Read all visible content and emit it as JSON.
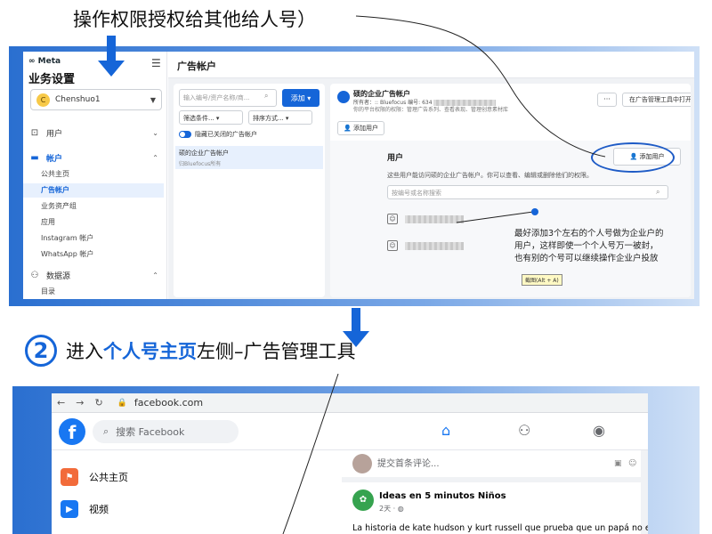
{
  "captions": {
    "step1": "操作权限授权给其他给人号）",
    "step2_num": "2",
    "step2_pre": "进入",
    "step2_highlight": "个人号主页",
    "step2_post": "左侧–广告管理工具"
  },
  "business_settings": {
    "logo": "∞ Meta",
    "title": "业务设置",
    "menu_icon": "hamburger-icon",
    "account": {
      "initial": "C",
      "name": "Chenshuo1"
    },
    "nav": [
      {
        "label": "用户",
        "icon": "users-icon"
      },
      {
        "label": "帐户",
        "icon": "folder-icon"
      },
      {
        "label": "数据源",
        "icon": "data-sources-icon"
      }
    ],
    "account_subitems": [
      "公共主页",
      "广告帐户",
      "业务资产组",
      "应用",
      "Instagram 帐户",
      "WhatsApp 帐户"
    ],
    "data_subitem": "目录",
    "header_title": "广告帐户",
    "list": {
      "search_placeholder": "输入编号/资产名称/商...",
      "add_label": "添加",
      "filter_label": "筛选条件...",
      "sort_label": "排序方式...",
      "toggle_label": "隐藏已关闭的广告帐户",
      "selected_account": {
        "name": "硕的企业广告帐户",
        "owner": "归Bluefocus所有"
      }
    },
    "detail": {
      "account_name": "硕的企业广告帐户",
      "owner_line": "所有者：:: Bluefocus  编号: 634",
      "perm_line": "你的平台权限的权限：管理广告系列、查看表现、管理创意素材库",
      "more_label": "···",
      "open_label": "在广告管理工具中打开",
      "add_user_top": "添加用户",
      "users_title": "用户",
      "users_desc": "这些用户能访问硕的企业广告帐户。你可以查看、编辑或删除他们的权限。",
      "users_search_placeholder": "按编号或名称搜索",
      "add_user_label": "添加用户",
      "note_lines": [
        "最好添加3个左右的个人号做为企业户的",
        "用户，这样即使一个个人号万一被封，",
        "也有别的个号可以继续操作企业户投放"
      ],
      "tooltip": "截图(Alt + A)"
    }
  },
  "facebook": {
    "url": "facebook.com",
    "logo": "f",
    "search_placeholder": "搜索 Facebook",
    "tabs": [
      "home-icon",
      "friends-icon",
      "groups-icon"
    ],
    "left_items": [
      {
        "label": "公共主页",
        "icon": "flag-icon",
        "color": "#f26b3a"
      },
      {
        "label": "视频",
        "icon": "video-icon",
        "color": "#1877f2"
      }
    ],
    "comment_placeholder": "提交首条评论...",
    "post": {
      "avatar": "✿",
      "name": "Ideas en 5 minutos Niños",
      "time": "2天 · ",
      "text": "La historia de kate hudson y kurt russell que prueba que un papá no e"
    }
  }
}
